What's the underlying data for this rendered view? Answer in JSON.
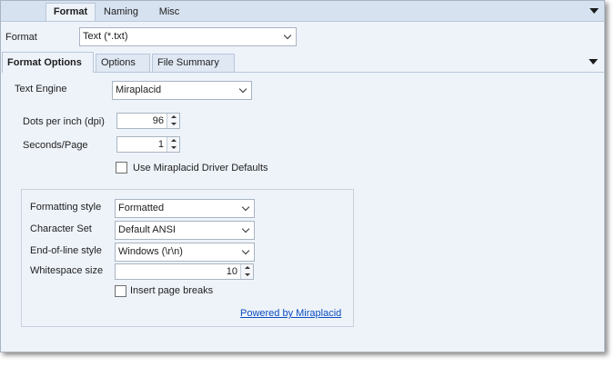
{
  "top_tabs": [
    "Format",
    "Naming",
    "Misc"
  ],
  "format": {
    "label": "Format",
    "value": "Text (*.txt)"
  },
  "sub_tabs": [
    "Format Options",
    "Options",
    "File Summary"
  ],
  "text_engine": {
    "label": "Text Engine",
    "value": "Miraplacid"
  },
  "dpi": {
    "label": "Dots per inch (dpi)",
    "value": "96"
  },
  "seconds_page": {
    "label": "Seconds/Page",
    "value": "1"
  },
  "driver_defaults": {
    "label": "Use Miraplacid Driver Defaults",
    "checked": false
  },
  "group": {
    "formatting_style": {
      "label": "Formatting style",
      "value": "Formatted"
    },
    "character_set": {
      "label": "Character Set",
      "value": "Default ANSI"
    },
    "eol_style": {
      "label": "End-of-line style",
      "value": "Windows (\\r\\n)"
    },
    "whitespace": {
      "label": "Whitespace size",
      "value": "10"
    },
    "page_breaks": {
      "label": "Insert page breaks",
      "checked": false
    },
    "powered_by": "Powered by Miraplacid"
  },
  "icons": [
    "chevron-down-icon",
    "spin-up-icon",
    "spin-down-icon",
    "checkbox-icon",
    "expand-arrow-icon"
  ],
  "colors": {
    "panel_bg": "#eef3fa",
    "tabstrip_bg": "#d6e2f0",
    "link": "#0b4dbd",
    "border": "#a9b4c2"
  }
}
